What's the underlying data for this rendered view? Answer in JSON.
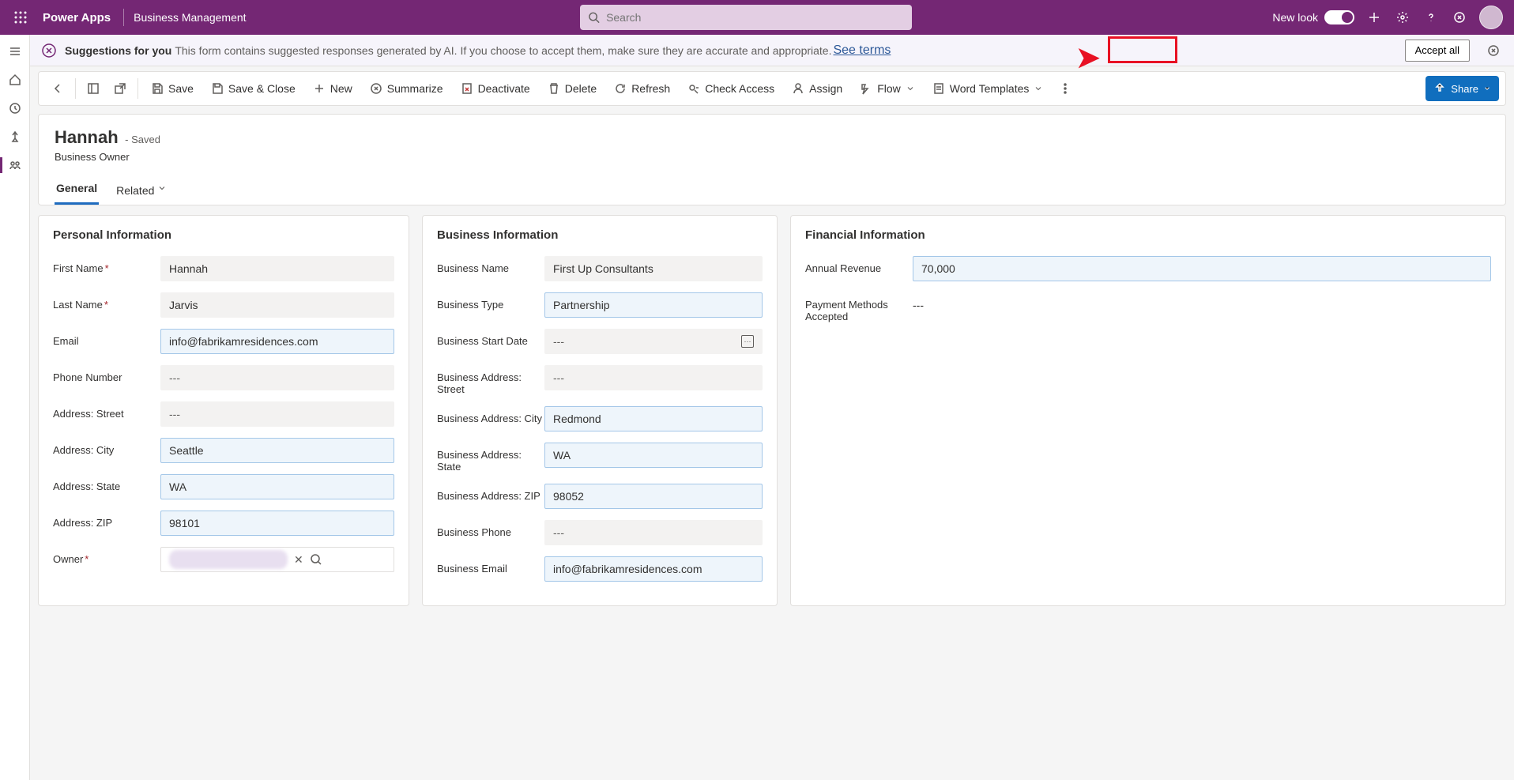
{
  "topbar": {
    "app_title": "Power Apps",
    "environment": "Business Management",
    "search_placeholder": "Search",
    "new_look_label": "New look"
  },
  "suggestion_bar": {
    "label": "Suggestions for you",
    "text": "This form contains suggested responses generated by AI. If you choose to accept them, make sure they are accurate and appropriate.",
    "link_text": "See terms",
    "accept_all": "Accept all"
  },
  "commands": {
    "save": "Save",
    "save_close": "Save & Close",
    "new": "New",
    "summarize": "Summarize",
    "deactivate": "Deactivate",
    "delete": "Delete",
    "refresh": "Refresh",
    "check_access": "Check Access",
    "assign": "Assign",
    "flow": "Flow",
    "word_templates": "Word Templates",
    "share": "Share"
  },
  "record": {
    "name": "Hannah",
    "status": "- Saved",
    "subtitle": "Business Owner",
    "tabs": {
      "general": "General",
      "related": "Related"
    }
  },
  "personal": {
    "section": "Personal Information",
    "first_name_label": "First Name",
    "first_name": "Hannah",
    "last_name_label": "Last Name",
    "last_name": "Jarvis",
    "email_label": "Email",
    "email": "info@fabrikamresidences.com",
    "phone_label": "Phone Number",
    "phone": "---",
    "street_label": "Address: Street",
    "street": "---",
    "city_label": "Address: City",
    "city": "Seattle",
    "state_label": "Address: State",
    "state": "WA",
    "zip_label": "Address: ZIP",
    "zip": "98101",
    "owner_label": "Owner"
  },
  "business": {
    "section": "Business Information",
    "name_label": "Business Name",
    "name": "First Up Consultants",
    "type_label": "Business Type",
    "type": "Partnership",
    "start_date_label": "Business Start Date",
    "start_date": "---",
    "street_label": "Business Address: Street",
    "street": "---",
    "city_label": "Business Address: City",
    "city": "Redmond",
    "state_label": "Business Address: State",
    "state": "WA",
    "zip_label": "Business Address: ZIP",
    "zip": "98052",
    "phone_label": "Business Phone",
    "phone": "---",
    "email_label": "Business Email",
    "email": "info@fabrikamresidences.com"
  },
  "financial": {
    "section": "Financial Information",
    "revenue_label": "Annual Revenue",
    "revenue": "70,000",
    "payment_label": "Payment Methods Accepted",
    "payment": "---"
  }
}
